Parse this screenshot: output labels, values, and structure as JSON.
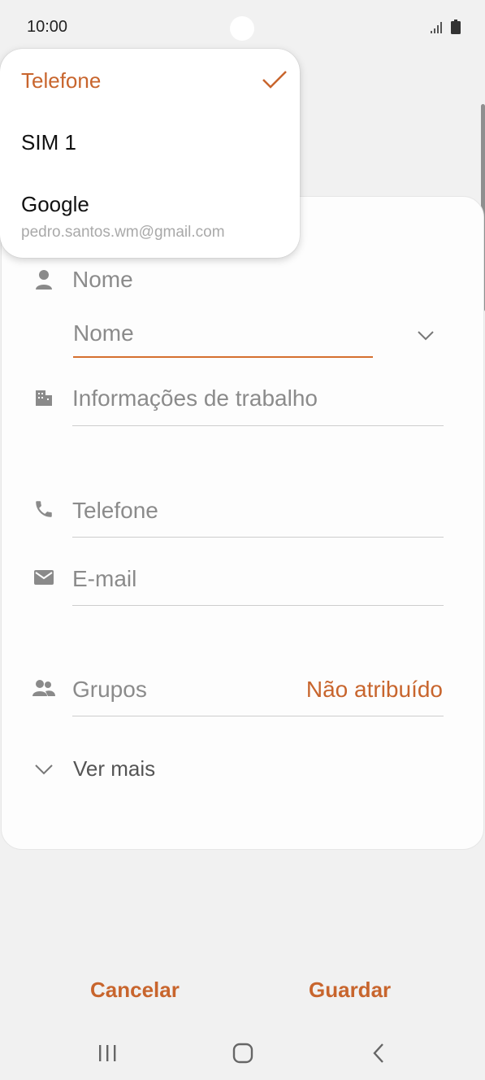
{
  "status_bar": {
    "time": "10:00",
    "icons": [
      "signal-icon",
      "battery-icon"
    ]
  },
  "account_menu": {
    "items": [
      {
        "label": "Telefone",
        "selected": true,
        "sub": ""
      },
      {
        "label": "SIM 1",
        "selected": false,
        "sub": ""
      },
      {
        "label": "Google",
        "selected": false,
        "sub": "pedro.santos.wm@gmail.com"
      }
    ]
  },
  "form": {
    "name_section_label": "Nome",
    "name_input_placeholder": "Nome",
    "work_info_label": "Informações de trabalho",
    "phone_label": "Telefone",
    "email_label": "E-mail",
    "groups_label": "Grupos",
    "groups_value": "Não atribuído",
    "see_more_label": "Ver mais"
  },
  "actions": {
    "cancel": "Cancelar",
    "save": "Guardar"
  },
  "colors": {
    "accent": "#c8652d",
    "background": "#f1f1f1",
    "card": "#fdfdfd"
  }
}
